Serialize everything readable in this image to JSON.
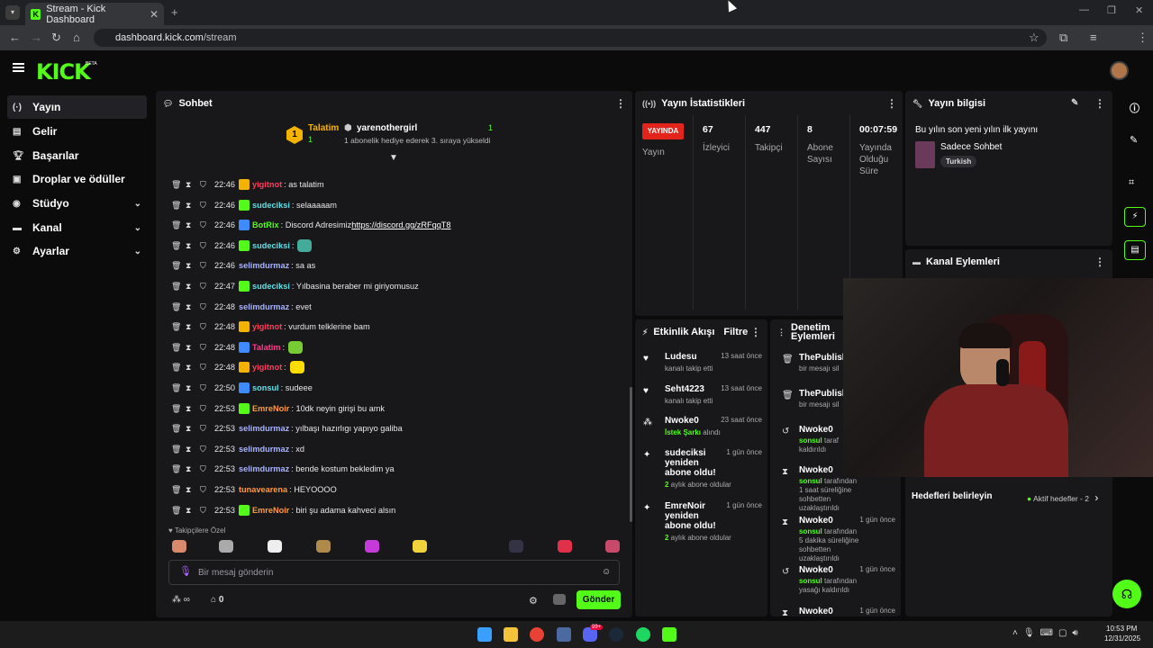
{
  "browser": {
    "tab_title": "Stream - Kick Dashboard",
    "url_host": "dashboard.kick.com",
    "url_path": "/stream"
  },
  "app": {
    "logo": "KICK",
    "beta": "BETA"
  },
  "sidebar": {
    "items": [
      {
        "label": "Yayın",
        "icon": "stream-icon"
      },
      {
        "label": "Gelir",
        "icon": "revenue-icon"
      },
      {
        "label": "Başarılar",
        "icon": "trophy-icon"
      },
      {
        "label": "Droplar ve ödüller",
        "icon": "gift-icon"
      },
      {
        "label": "Stüdyo",
        "icon": "studio-icon"
      },
      {
        "label": "Kanal",
        "icon": "channel-icon"
      },
      {
        "label": "Ayarlar",
        "icon": "gear-icon"
      }
    ]
  },
  "chat": {
    "title": "Sohbet",
    "pinned": {
      "rank": "1",
      "name": "Talatim",
      "count": "1",
      "gifter": "yarenothergirl",
      "gift_count": "1",
      "gift_text": "1 abonelik hediye ederek 3. sıraya yükseldi"
    },
    "messages": [
      {
        "time": "22:46",
        "user": "yigitnot",
        "text": ": as talatim",
        "color": "#ff3d5b",
        "badge": "#f5b301"
      },
      {
        "time": "22:46",
        "user": "sudeciksi",
        "text": ": selaaaaam",
        "color": "#5ee0e6",
        "badge": "#53fc18"
      },
      {
        "time": "22:46",
        "user": "BotRix",
        "text": ": Discord Adresimiz ",
        "link": "https://discord.gg/zRFqqT8",
        "color": "#53fc18",
        "badge": "#3d8bff"
      },
      {
        "time": "22:46",
        "user": "sudeciksi",
        "text": ":",
        "color": "#5ee0e6",
        "badge": "#53fc18",
        "emote": "#4a9"
      },
      {
        "time": "22:46",
        "user": "selimdurmaz",
        "text": ": sa as",
        "color": "#a8b4ff",
        "badge": ""
      },
      {
        "time": "22:47",
        "user": "sudeciksi",
        "text": ": Yılbasina beraber mi giriyomusuz",
        "color": "#5ee0e6",
        "badge": "#53fc18"
      },
      {
        "time": "22:48",
        "user": "selimdurmaz",
        "text": ": evet",
        "color": "#a8b4ff",
        "badge": ""
      },
      {
        "time": "22:48",
        "user": "yigitnot",
        "text": ": vurdum telklerine bam",
        "color": "#ff3d5b",
        "badge": "#f5b301"
      },
      {
        "time": "22:48",
        "user": "Talatim",
        "text": ":",
        "color": "#ff3d8b",
        "badge": "#3d8bff",
        "emote": "#7c3"
      },
      {
        "time": "22:48",
        "user": "yigitnot",
        "text": ":",
        "color": "#ff3d5b",
        "badge": "#f5b301",
        "emote": "#fd0"
      },
      {
        "time": "22:50",
        "user": "sonsul",
        "text": ": sudeee",
        "color": "#5ee0e6",
        "badge": "#3d8bff"
      },
      {
        "time": "22:53",
        "user": "EmreNoir",
        "text": ": 10dk neyin girişi bu amk",
        "color": "#ff9a3d",
        "badge": "#53fc18"
      },
      {
        "time": "22:53",
        "user": "selimdurmaz",
        "text": ": yılbaşı hazırlıgı yapıyo galiba",
        "color": "#a8b4ff",
        "badge": ""
      },
      {
        "time": "22:53",
        "user": "selimdurmaz",
        "text": ": xd",
        "color": "#a8b4ff",
        "badge": ""
      },
      {
        "time": "22:53",
        "user": "selimdurmaz",
        "text": ": bende kostum bekledim ya",
        "color": "#a8b4ff",
        "badge": ""
      },
      {
        "time": "22:53",
        "user": "tunavearena",
        "text": ": HEYOOOO",
        "color": "#ff9a3d",
        "badge": ""
      },
      {
        "time": "22:53",
        "user": "EmreNoir",
        "text": ": biri şu adama kahveci alsın",
        "color": "#ff9a3d",
        "badge": "#53fc18"
      }
    ],
    "followers_only": "Takipçilere Özel",
    "input_placeholder": "Bir mesaj gönderin",
    "infinity": "∞",
    "points": "0",
    "send": "Gönder"
  },
  "stats": {
    "title": "Yayın İstatistikleri",
    "live": "YAYINDA",
    "live_label": "Yayın",
    "cols": [
      {
        "value": "67",
        "label": "İzleyici"
      },
      {
        "value": "447",
        "label": "Takipçi"
      },
      {
        "value": "8",
        "label": "Abone Sayısı"
      },
      {
        "value": "00:07:59",
        "label": "Yayında Olduğu Süre"
      }
    ]
  },
  "info": {
    "title": "Yayın bilgisi",
    "stream_title": "Bu yılın son yeni yılın ilk yayını",
    "category": "Sadece Sohbet",
    "tag": "Turkish"
  },
  "actions": {
    "title": "Kanal Eylemleri"
  },
  "activity": {
    "title": "Etkinlik Akışı",
    "filter": "Filtre",
    "items": [
      {
        "name": "Ludesu",
        "sub": "kanalı takip etti",
        "ago": "13 saat önce",
        "icon": "heart-icon"
      },
      {
        "name": "Seht4223",
        "sub": "kanalı takip etti",
        "ago": "13 saat önce",
        "icon": "heart-icon"
      },
      {
        "name": "Nwoke0",
        "sub_hl": "İstek Şarkı",
        "sub": " alındı",
        "ago": "23 saat önce",
        "icon": "reward-icon"
      },
      {
        "name": "sudeciksi yeniden abone oldu!",
        "sub_hl": "2",
        "sub": " aylık abone oldular",
        "ago": "1 gün önce",
        "icon": "sparkle-icon"
      },
      {
        "name": "EmreNoir yeniden abone oldu!",
        "sub_hl": "2",
        "sub": " aylık abone oldular",
        "ago": "1 gün önce",
        "icon": "sparkle-icon"
      }
    ]
  },
  "moderation": {
    "title": "Denetim Eylemleri",
    "items": [
      {
        "name": "ThePublish",
        "sub": "bir mesajı sil",
        "ago": "",
        "icon": "trash-icon"
      },
      {
        "name": "ThePublish",
        "sub": "bir mesajı sil",
        "ago": "",
        "icon": "trash-icon"
      },
      {
        "name": "Nwoke0",
        "sub_hl": "sonsul",
        "sub": " taraf kaldırıldı",
        "ago": "",
        "icon": "undo-icon"
      },
      {
        "name": "Nwoke0",
        "sub_hl": "sonsul",
        "sub": " tarafından 1 saat süreliğine sohbetten uzaklaştırıldı",
        "ago": "",
        "icon": "timer-icon"
      },
      {
        "name": "Nwoke0",
        "sub_hl": "sonsul",
        "sub": " tarafından 5 dakika süreliğine sohbetten uzaklaştırıldı",
        "ago": "1 gün önce",
        "icon": "timer-icon"
      },
      {
        "name": "Nwoke0",
        "sub_hl": "sonsul",
        "sub": " tarafından yasağı kaldırıldı",
        "ago": "1 gün önce",
        "icon": "undo-icon"
      },
      {
        "name": "Nwoke0",
        "sub": "",
        "ago": "1 gün önce",
        "icon": "timer-icon"
      }
    ]
  },
  "goals": {
    "title": "Hedefleri belirleyin",
    "active": "Aktif hedefler - 2"
  },
  "taskbar": {
    "time": "10:53 PM",
    "date": "12/31/2025",
    "badge": "99+"
  }
}
